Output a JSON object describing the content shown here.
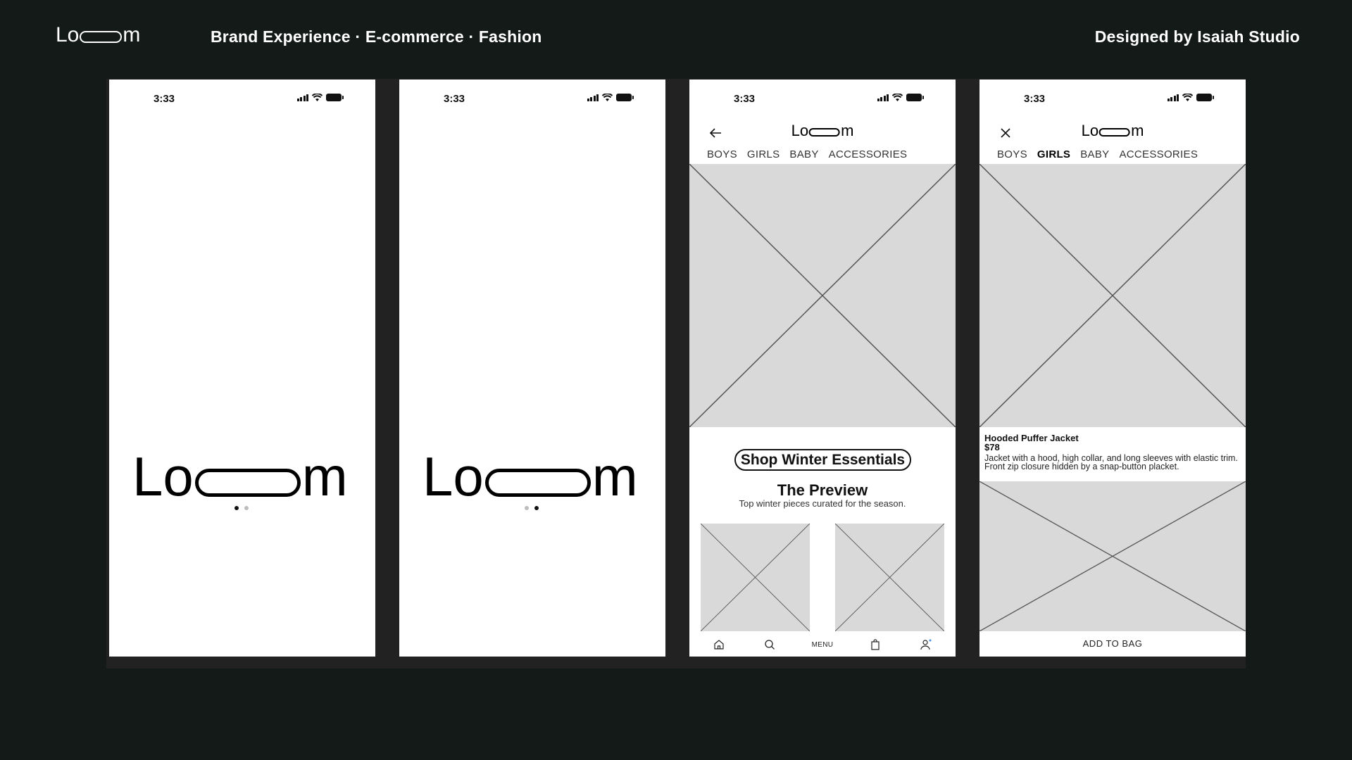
{
  "header": {
    "logo_prefix": "Lo",
    "logo_suffix": "m",
    "subtitle": "Brand Experience · E-commerce · Fashion",
    "credit": "Designed by Isaiah Studio"
  },
  "status_bar": {
    "time": "3:33"
  },
  "splash": {
    "logo_prefix": "Lo",
    "logo_suffix": "m",
    "pages": 2
  },
  "nav": {
    "items": [
      "BOYS",
      "GIRLS",
      "BABY",
      "ACCESSORIES"
    ],
    "screen3_active": null,
    "screen4_active": "GIRLS"
  },
  "home": {
    "cta": "Shop Winter Essentials",
    "section_title": "The Preview",
    "section_subtitle": "Top winter pieces curated for the season.",
    "tabbar": {
      "home_icon": "home-icon",
      "search_icon": "search-icon",
      "menu_label": "MENU",
      "bag_icon": "bag-icon",
      "profile_icon": "profile-icon"
    }
  },
  "product": {
    "name": "Hooded Puffer Jacket",
    "price": "$78",
    "description": "Jacket with a hood, high collar, and long sleeves with elastic trim. Front zip closure hidden by a snap-button placket.",
    "add_to_bag": "ADD TO BAG"
  },
  "colors": {
    "background": "#131a18",
    "board": "#222222",
    "placeholder": "#d9d9d9",
    "accent_dot": "#4a90e2"
  }
}
